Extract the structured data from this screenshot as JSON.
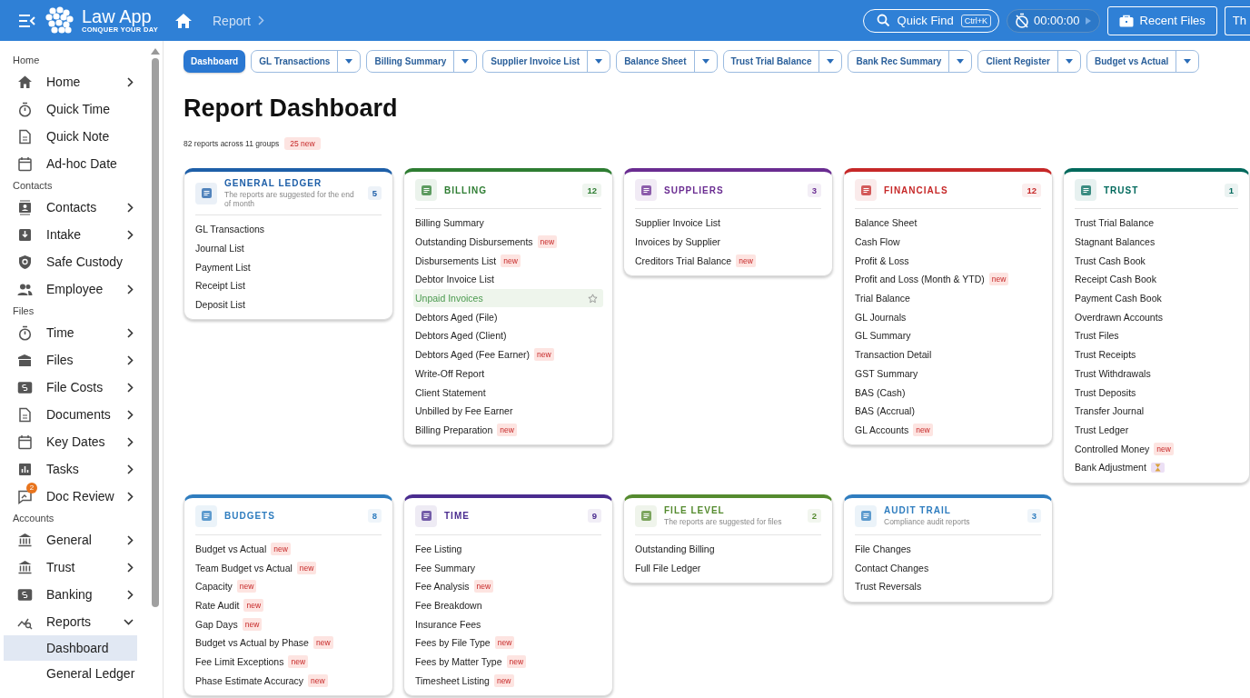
{
  "topbar": {
    "app_name": "Law App",
    "tagline": "CONQUER YOUR DAY",
    "breadcrumb": "Report",
    "quick_find": {
      "label": "Quick Find",
      "shortcut": "Ctrl+K"
    },
    "timer": "00:00:00",
    "recent_files": "Recent Files",
    "cut_button": "Th"
  },
  "sidebar": [
    {
      "title": "Home",
      "items": [
        {
          "label": "Home",
          "expandable": true
        },
        {
          "label": "Quick Time",
          "expandable": false
        },
        {
          "label": "Quick Note",
          "expandable": false
        },
        {
          "label": "Ad-hoc Date",
          "expandable": false
        }
      ]
    },
    {
      "title": "Contacts",
      "items": [
        {
          "label": "Contacts",
          "expandable": true
        },
        {
          "label": "Intake",
          "expandable": true
        },
        {
          "label": "Safe Custody",
          "expandable": false
        },
        {
          "label": "Employee",
          "expandable": true
        }
      ]
    },
    {
      "title": "Files",
      "items": [
        {
          "label": "Time",
          "expandable": true
        },
        {
          "label": "Files",
          "expandable": true
        },
        {
          "label": "File Costs",
          "expandable": true
        },
        {
          "label": "Documents",
          "expandable": true
        },
        {
          "label": "Key Dates",
          "expandable": true
        },
        {
          "label": "Tasks",
          "expandable": true
        },
        {
          "label": "Doc Review",
          "expandable": true,
          "badge": "2"
        }
      ]
    },
    {
      "title": "Accounts",
      "items": [
        {
          "label": "General",
          "expandable": true
        },
        {
          "label": "Trust",
          "expandable": true
        },
        {
          "label": "Banking",
          "expandable": true
        },
        {
          "label": "Reports",
          "expandable": true,
          "expanded": true,
          "children": [
            {
              "label": "Dashboard",
              "selected": true
            },
            {
              "label": "General Ledger",
              "selected": false
            }
          ]
        }
      ]
    }
  ],
  "tabs": [
    {
      "label": "Dashboard",
      "selected": true
    },
    {
      "label": "GL Transactions",
      "selected": false
    },
    {
      "label": "Billing Summary",
      "selected": false
    },
    {
      "label": "Supplier Invoice List",
      "selected": false
    },
    {
      "label": "Balance Sheet",
      "selected": false
    },
    {
      "label": "Trust Trial Balance",
      "selected": false
    },
    {
      "label": "Bank Rec Summary",
      "selected": false
    },
    {
      "label": "Client Register",
      "selected": false
    },
    {
      "label": "Budget vs Actual",
      "selected": false
    }
  ],
  "title": "Report Dashboard",
  "summary": "82 reports across 11 groups",
  "new_badge": "25 new",
  "groups": [
    {
      "title": "GENERAL LEDGER",
      "subtitle": "The reports are suggested for the end of month",
      "count": "5",
      "color": "#1e5fa8",
      "items": [
        {
          "label": "GL Transactions",
          "selected": false
        },
        {
          "label": "Journal List",
          "selected": false
        },
        {
          "label": "Payment List",
          "selected": false
        },
        {
          "label": "Receipt List",
          "selected": false
        },
        {
          "label": "Deposit List",
          "selected": false
        }
      ]
    },
    {
      "title": "BILLING",
      "count": "12",
      "color": "#2e7d32",
      "items": [
        {
          "label": "Billing Summary",
          "selected": false
        },
        {
          "label": "Outstanding Disbursements",
          "tag": "new",
          "selected": false
        },
        {
          "label": "Disbursements List",
          "tag": "new",
          "selected": false
        },
        {
          "label": "Debtor Invoice List",
          "selected": false
        },
        {
          "label": "Unpaid Invoices",
          "selected": true
        },
        {
          "label": "Debtors Aged (File)",
          "selected": false
        },
        {
          "label": "Debtors Aged (Client)",
          "selected": false
        },
        {
          "label": "Debtors Aged (Fee Earner)",
          "tag": "new",
          "selected": false
        },
        {
          "label": "Write-Off Report",
          "selected": false
        },
        {
          "label": "Client Statement",
          "selected": false
        },
        {
          "label": "Unbilled by Fee Earner",
          "selected": false
        },
        {
          "label": "Billing Preparation",
          "tag": "new",
          "selected": false
        }
      ]
    },
    {
      "title": "SUPPLIERS",
      "count": "3",
      "color": "#6a2c91",
      "items": [
        {
          "label": "Supplier Invoice List",
          "selected": false
        },
        {
          "label": "Invoices by Supplier",
          "selected": false
        },
        {
          "label": "Creditors Trial Balance",
          "tag": "new",
          "selected": false
        }
      ]
    },
    {
      "title": "FINANCIALS",
      "count": "12",
      "color": "#c62828",
      "items": [
        {
          "label": "Balance Sheet",
          "selected": false
        },
        {
          "label": "Cash Flow",
          "selected": false
        },
        {
          "label": "Profit & Loss",
          "selected": false
        },
        {
          "label": "Profit and Loss (Month & YTD)",
          "tag": "new",
          "selected": false
        },
        {
          "label": "Trial Balance",
          "selected": false
        },
        {
          "label": "GL Journals",
          "selected": false
        },
        {
          "label": "GL Summary",
          "selected": false
        },
        {
          "label": "Transaction Detail",
          "selected": false
        },
        {
          "label": "GST Summary",
          "selected": false
        },
        {
          "label": "BAS (Cash)",
          "selected": false
        },
        {
          "label": "BAS (Accrual)",
          "selected": false
        },
        {
          "label": "GL Accounts",
          "tag": "new",
          "selected": false
        }
      ]
    },
    {
      "title": "TRUST",
      "count": "1",
      "color": "#00695c",
      "items": [
        {
          "label": "Trust Trial Balance",
          "selected": false
        },
        {
          "label": "Stagnant Balances",
          "selected": false
        },
        {
          "label": "Trust Cash Book",
          "selected": false
        },
        {
          "label": "Receipt Cash Book",
          "selected": false
        },
        {
          "label": "Payment Cash Book",
          "selected": false
        },
        {
          "label": "Overdrawn Accounts",
          "selected": false
        },
        {
          "label": "Trust Files",
          "selected": false
        },
        {
          "label": "Trust Receipts",
          "selected": false
        },
        {
          "label": "Trust Withdrawals",
          "selected": false
        },
        {
          "label": "Trust Deposits",
          "selected": false
        },
        {
          "label": "Transfer Journal",
          "selected": false
        },
        {
          "label": "Trust Ledger",
          "selected": false
        },
        {
          "label": "Controlled Money",
          "tag": "new",
          "selected": false
        },
        {
          "label": "Bank Adjustment",
          "pending": true,
          "selected": false
        }
      ]
    },
    {
      "title": "BUDGETS",
      "count": "8",
      "color": "#2f7dbf",
      "items": [
        {
          "label": "Budget vs Actual",
          "tag": "new",
          "selected": false
        },
        {
          "label": "Team Budget vs Actual",
          "tag": "new",
          "selected": false
        },
        {
          "label": "Capacity",
          "tag": "new",
          "selected": false
        },
        {
          "label": "Rate Audit",
          "tag": "new",
          "selected": false
        },
        {
          "label": "Gap Days",
          "tag": "new",
          "selected": false
        },
        {
          "label": "Budget vs Actual by Phase",
          "tag": "new",
          "selected": false
        },
        {
          "label": "Fee Limit Exceptions",
          "tag": "new",
          "selected": false
        },
        {
          "label": "Phase Estimate Accuracy",
          "tag": "new",
          "selected": false
        }
      ]
    },
    {
      "title": "TIME",
      "count": "9",
      "color": "#4a2c8f",
      "items": [
        {
          "label": "Fee Listing",
          "selected": false
        },
        {
          "label": "Fee Summary",
          "selected": false
        },
        {
          "label": "Fee Analysis",
          "tag": "new",
          "selected": false
        },
        {
          "label": "Fee Breakdown",
          "selected": false
        },
        {
          "label": "Insurance Fees",
          "selected": false
        },
        {
          "label": "Fees by File Type",
          "tag": "new",
          "selected": false
        },
        {
          "label": "Fees by Matter Type",
          "tag": "new",
          "selected": false
        },
        {
          "label": "Timesheet Listing",
          "tag": "new",
          "selected": false
        }
      ]
    },
    {
      "title": "FILE LEVEL",
      "subtitle": "The reports are suggested for files",
      "count": "2",
      "color": "#558b2f",
      "items": [
        {
          "label": "Outstanding Billing",
          "selected": false
        },
        {
          "label": "Full File Ledger",
          "selected": false
        }
      ]
    },
    {
      "title": "AUDIT TRAIL",
      "subtitle": "Compliance audit reports",
      "count": "3",
      "color": "#2f7dbf",
      "items": [
        {
          "label": "File Changes",
          "selected": false
        },
        {
          "label": "Contact Changes",
          "selected": false
        },
        {
          "label": "Trust Reversals",
          "selected": false
        }
      ]
    }
  ]
}
